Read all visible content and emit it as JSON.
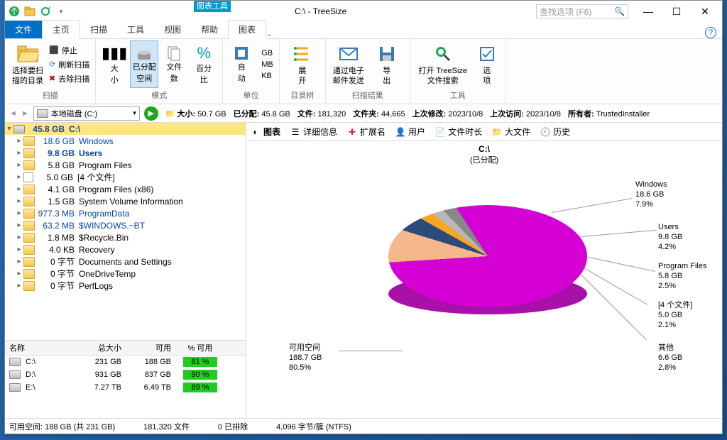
{
  "title": "C:\\ - TreeSize",
  "tool_tab": "图表工具",
  "search_placeholder": "查找选项 (F6)",
  "tabs": {
    "file": "文件",
    "home": "主页",
    "scan": "扫描",
    "tools": "工具",
    "view": "视图",
    "help": "帮助",
    "chart": "图表"
  },
  "ribbon": {
    "g1": {
      "select_dir": "选择要扫\n描的目录",
      "stop": "停止",
      "refresh": "刷新扫描",
      "remove": "去除扫描",
      "label": "扫描"
    },
    "g2": {
      "size": "大\n小",
      "alloc": "已分配\n空间",
      "files": "文件\n数",
      "pct": "百分\n比",
      "label": "模式"
    },
    "g3": {
      "auto": "自\n动",
      "gb": "GB",
      "mb": "MB",
      "kb": "KB",
      "label": "单位"
    },
    "g4": {
      "expand": "展\n开",
      "label": "目录树"
    },
    "g5": {
      "email": "通过电子\n邮件发送",
      "export": "导\n出",
      "label": "扫描结果"
    },
    "g6": {
      "search": "打开 TreeSize\n 文件搜索",
      "options": "选\n项",
      "label": "工具"
    }
  },
  "toolbar": {
    "drive": "本地磁盘 (C:)",
    "size": {
      "label": "大小:",
      "value": "50.7 GB"
    },
    "alloc": {
      "label": "已分配:",
      "value": "45.8 GB"
    },
    "files": {
      "label": "文件:",
      "value": "181,320"
    },
    "dirs": {
      "label": "文件夹:",
      "value": "44,665"
    },
    "modified": {
      "label": "上次修改:",
      "value": "2023/10/8"
    },
    "accessed": {
      "label": "上次访问:",
      "value": "2023/10/8"
    },
    "owner": {
      "label": "所有者:",
      "value": "TrustedInstaller"
    }
  },
  "tree": {
    "root": {
      "size": "45.8 GB",
      "name": "C:\\"
    },
    "rows": [
      {
        "size": "18.6 GB",
        "name": "Windows",
        "link": true,
        "bar": 40
      },
      {
        "size": "9.8 GB",
        "name": "Users",
        "link": true,
        "bar": 21,
        "bold": true
      },
      {
        "size": "5.8 GB",
        "name": "Program Files",
        "bar": 13
      },
      {
        "size": "5.0 GB",
        "name": "[4 个文件]",
        "file": true,
        "bar": 11
      },
      {
        "size": "4.1 GB",
        "name": "Program Files (x86)",
        "bar": 9
      },
      {
        "size": "1.5 GB",
        "name": "System Volume Information",
        "bar": 3
      },
      {
        "size": "977.3 MB",
        "name": "ProgramData",
        "link": true,
        "bar": 2
      },
      {
        "size": "63.2 MB",
        "name": "$WINDOWS.~BT",
        "link": true,
        "bar": 1
      },
      {
        "size": "1.8 MB",
        "name": "$Recycle.Bin",
        "bar": 0
      },
      {
        "size": "4.0 KB",
        "name": "Recovery",
        "bar": 0
      },
      {
        "size": "0 字节",
        "name": "Documents and Settings",
        "bar": 0
      },
      {
        "size": "0 字节",
        "name": "OneDriveTemp",
        "bar": 0
      },
      {
        "size": "0 字节",
        "name": "PerfLogs",
        "bar": 0
      }
    ]
  },
  "drives": {
    "headers": {
      "name": "名称",
      "total": "总大小",
      "avail": "可用",
      "pct": "% 可用"
    },
    "rows": [
      {
        "name": "C:\\",
        "total": "231 GB",
        "avail": "188 GB",
        "pct": "81 %"
      },
      {
        "name": "D:\\",
        "total": "931 GB",
        "avail": "837 GB",
        "pct": "90 %"
      },
      {
        "name": "E:\\",
        "total": "7.27 TB",
        "avail": "6.49 TB",
        "pct": "89 %"
      }
    ]
  },
  "right_tabs": {
    "chart": "图表",
    "details": "详细信息",
    "ext": "扩展名",
    "users": "用户",
    "age": "文件时长",
    "big": "大文件",
    "history": "历史"
  },
  "chart": {
    "title": "C:\\",
    "subtitle": "(已分配)",
    "labels": {
      "free": "可用空间\n188.7 GB\n80.5%",
      "windows": "Windows\n18.6 GB\n7.9%",
      "users": "Users\n9.8 GB\n4.2%",
      "programfiles": "Program Files\n5.8 GB\n2.5%",
      "files4": "[4 个文件]\n5.0 GB\n2.1%",
      "other": "其他\n6.6 GB\n2.8%"
    }
  },
  "chart_data": {
    "type": "pie",
    "title": "C:\\ (已分配)",
    "series": [
      {
        "name": "可用空间",
        "value": 188.7,
        "unit": "GB",
        "pct": 80.5,
        "color": "#d400d4"
      },
      {
        "name": "Windows",
        "value": 18.6,
        "unit": "GB",
        "pct": 7.9,
        "color": "#f5b88d"
      },
      {
        "name": "Users",
        "value": 9.8,
        "unit": "GB",
        "pct": 4.2,
        "color": "#2c4a7a"
      },
      {
        "name": "Program Files",
        "value": 5.8,
        "unit": "GB",
        "pct": 2.5,
        "color": "#f5a623"
      },
      {
        "name": "[4 个文件]",
        "value": 5.0,
        "unit": "GB",
        "pct": 2.1,
        "color": "#b8b8b8"
      },
      {
        "name": "其他",
        "value": 6.6,
        "unit": "GB",
        "pct": 2.8,
        "color": "#888888"
      }
    ]
  },
  "status": {
    "free": "可用空间: 188 GB  (共 231 GB)",
    "files": "181,320 文件",
    "excluded": "0 已排除",
    "cluster": "4,096 字节/簇 (NTFS)"
  }
}
